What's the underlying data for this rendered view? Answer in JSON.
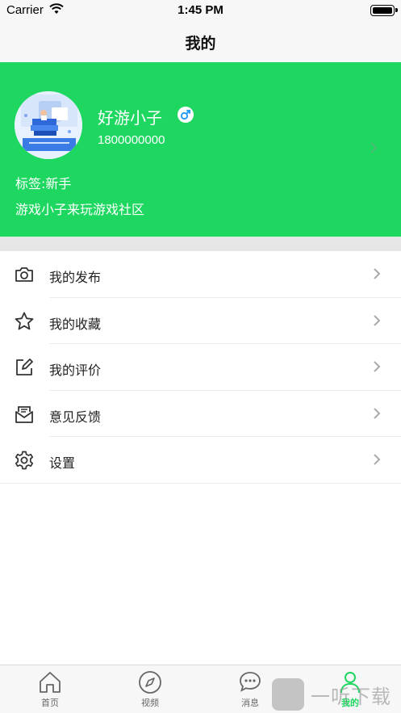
{
  "status_bar": {
    "carrier": "Carrier",
    "time": "1:45 PM"
  },
  "nav": {
    "title": "我的"
  },
  "profile": {
    "nickname": "好游小子",
    "gender": "male",
    "phone": "1800000000",
    "tag": "标签:新手",
    "intro": "游戏小子来玩游戏社区",
    "background_color": "#1ed760",
    "gender_color": "#2a9df4"
  },
  "menu": {
    "items": [
      {
        "label": "我的发布",
        "icon": "camera-icon"
      },
      {
        "label": "我的收藏",
        "icon": "star-icon"
      },
      {
        "label": "我的评价",
        "icon": "edit-icon"
      },
      {
        "label": "意见反馈",
        "icon": "mail-icon"
      },
      {
        "label": "设置",
        "icon": "gear-icon"
      }
    ]
  },
  "tab_bar": {
    "active_color": "#1ed760",
    "tabs": [
      {
        "label": "首页",
        "icon": "home-icon"
      },
      {
        "label": "视频",
        "icon": "compass-icon"
      },
      {
        "label": "消息",
        "icon": "chat-icon"
      },
      {
        "label": "我的",
        "icon": "person-icon",
        "active": true
      }
    ]
  },
  "watermark": {
    "text": "一听下载"
  }
}
